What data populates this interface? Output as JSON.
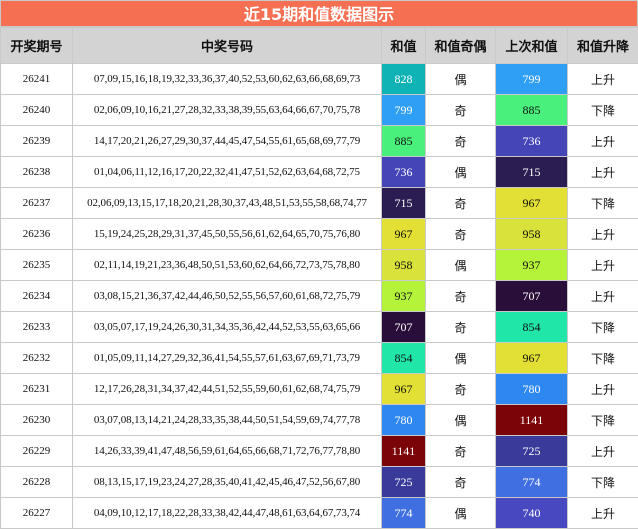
{
  "title": "近15期和值数据图示",
  "headers": {
    "period": "开奖期号",
    "numbers": "中奖号码",
    "sum": "和值",
    "parity": "和值奇偶",
    "prev_sum": "上次和值",
    "trend": "和值升降"
  },
  "rows": [
    {
      "period": "26241",
      "numbers": "07,09,15,16,18,19,32,33,36,37,40,52,53,60,62,63,66,68,69,73",
      "sum": "828",
      "sum_color": "#0fb3b6",
      "parity": "偶",
      "prev_sum": "799",
      "prev_color": "#2f9ef5",
      "trend": "上升"
    },
    {
      "period": "26240",
      "numbers": "02,06,09,10,16,21,27,28,32,33,38,39,55,63,64,66,67,70,75,78",
      "sum": "799",
      "sum_color": "#2f9ef5",
      "parity": "奇",
      "prev_sum": "885",
      "prev_color": "#49f07c",
      "trend": "下降"
    },
    {
      "period": "26239",
      "numbers": "14,17,20,21,26,27,29,30,37,44,45,47,54,55,61,65,68,69,77,79",
      "sum": "885",
      "sum_color": "#49f07c",
      "parity": "奇",
      "prev_sum": "736",
      "prev_color": "#4545b8",
      "trend": "上升"
    },
    {
      "period": "26238",
      "numbers": "01,04,06,11,12,16,17,20,22,32,41,47,51,52,62,63,64,68,72,75",
      "sum": "736",
      "sum_color": "#4545b8",
      "parity": "偶",
      "prev_sum": "715",
      "prev_color": "#2b1c52",
      "trend": "上升"
    },
    {
      "period": "26237",
      "numbers": "02,06,09,13,15,17,18,20,21,28,30,37,43,48,51,53,55,58,68,74,77",
      "sum": "715",
      "sum_color": "#2b1c52",
      "parity": "奇",
      "prev_sum": "967",
      "prev_color": "#e2e035",
      "trend": "下降"
    },
    {
      "period": "26236",
      "numbers": "15,19,24,25,28,29,31,37,45,50,55,56,61,62,64,65,70,75,76,80",
      "sum": "967",
      "sum_color": "#e2e035",
      "parity": "奇",
      "prev_sum": "958",
      "prev_color": "#d8e23a",
      "trend": "上升"
    },
    {
      "period": "26235",
      "numbers": "02,11,14,19,21,23,36,48,50,51,53,60,62,64,66,72,73,75,78,80",
      "sum": "958",
      "sum_color": "#d8e23a",
      "parity": "偶",
      "prev_sum": "937",
      "prev_color": "#b5f23a",
      "trend": "上升"
    },
    {
      "period": "26234",
      "numbers": "03,08,15,21,36,37,42,44,46,50,52,55,56,57,60,61,68,72,75,79",
      "sum": "937",
      "sum_color": "#b5f23a",
      "parity": "奇",
      "prev_sum": "707",
      "prev_color": "#2a0e3a",
      "trend": "上升"
    },
    {
      "period": "26233",
      "numbers": "03,05,07,17,19,24,26,30,31,34,35,36,42,44,52,53,55,63,65,66",
      "sum": "707",
      "sum_color": "#2a0e3a",
      "parity": "奇",
      "prev_sum": "854",
      "prev_color": "#20e6a8",
      "trend": "下降"
    },
    {
      "period": "26232",
      "numbers": "01,05,09,11,14,27,29,32,36,41,54,55,57,61,63,67,69,71,73,79",
      "sum": "854",
      "sum_color": "#20e6a8",
      "parity": "偶",
      "prev_sum": "967",
      "prev_color": "#e2e035",
      "trend": "下降"
    },
    {
      "period": "26231",
      "numbers": "12,17,26,28,31,34,37,42,44,51,52,55,59,60,61,62,68,74,75,79",
      "sum": "967",
      "sum_color": "#e2e035",
      "parity": "奇",
      "prev_sum": "780",
      "prev_color": "#2f87f0",
      "trend": "上升"
    },
    {
      "period": "26230",
      "numbers": "03,07,08,13,14,21,24,28,33,35,38,44,50,51,54,59,69,74,77,78",
      "sum": "780",
      "sum_color": "#2f87f0",
      "parity": "偶",
      "prev_sum": "1141",
      "prev_color": "#7a0408",
      "trend": "下降"
    },
    {
      "period": "26229",
      "numbers": "14,26,33,39,41,47,48,56,59,61,64,65,66,68,71,72,76,77,78,80",
      "sum": "1141",
      "sum_color": "#7a0408",
      "parity": "奇",
      "prev_sum": "725",
      "prev_color": "#3a3a9a",
      "trend": "上升"
    },
    {
      "period": "26228",
      "numbers": "08,13,15,17,19,23,24,27,28,35,40,41,42,45,46,47,52,56,67,80",
      "sum": "725",
      "sum_color": "#3a3a9a",
      "parity": "奇",
      "prev_sum": "774",
      "prev_color": "#3f6fe0",
      "trend": "下降"
    },
    {
      "period": "26227",
      "numbers": "04,09,10,12,17,18,22,28,33,38,42,44,47,48,61,63,64,67,73,74",
      "sum": "774",
      "sum_color": "#3f6fe0",
      "parity": "偶",
      "prev_sum": "740",
      "prev_color": "#4848c0",
      "trend": "上升"
    }
  ]
}
